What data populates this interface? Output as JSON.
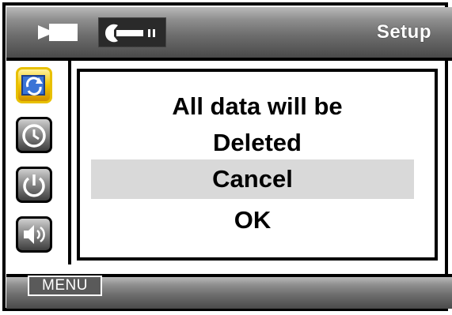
{
  "header": {
    "title": "Setup",
    "tabs": [
      {
        "icon": "camera-icon",
        "selected": false
      },
      {
        "icon": "wrench-icon",
        "selected": true
      }
    ]
  },
  "sidebar": {
    "items": [
      {
        "icon": "refresh-icon",
        "selected": true
      },
      {
        "icon": "clock-icon",
        "selected": false
      },
      {
        "icon": "power-icon",
        "selected": false
      },
      {
        "icon": "speaker-icon",
        "selected": false
      }
    ]
  },
  "dialog": {
    "message_line1": "All data will be",
    "message_line2": "Deleted",
    "options": [
      "Cancel",
      "OK"
    ],
    "highlighted_option": "Cancel"
  },
  "footer": {
    "menu_label": "MENU"
  },
  "colors": {
    "selected_accent": "#f2c400",
    "highlight": "#d9d9d9"
  }
}
